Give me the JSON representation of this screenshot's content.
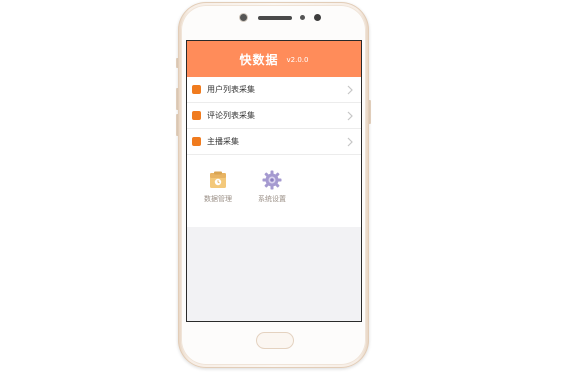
{
  "app": {
    "title": "快数据",
    "version": "v2.0.0"
  },
  "menu": {
    "items": [
      {
        "label": "用户列表采集",
        "icon": "orange-square-icon"
      },
      {
        "label": "评论列表采集",
        "icon": "orange-square-icon"
      },
      {
        "label": "主播采集",
        "icon": "orange-square-icon"
      }
    ]
  },
  "shortcuts": [
    {
      "label": "数据管理",
      "icon": "folder-icon"
    },
    {
      "label": "系统设置",
      "icon": "gear-icon"
    }
  ],
  "colors": {
    "header_bg": "#ff8c5a",
    "bullet": "#f07b1e",
    "screen_bg": "#f2f2f4"
  }
}
